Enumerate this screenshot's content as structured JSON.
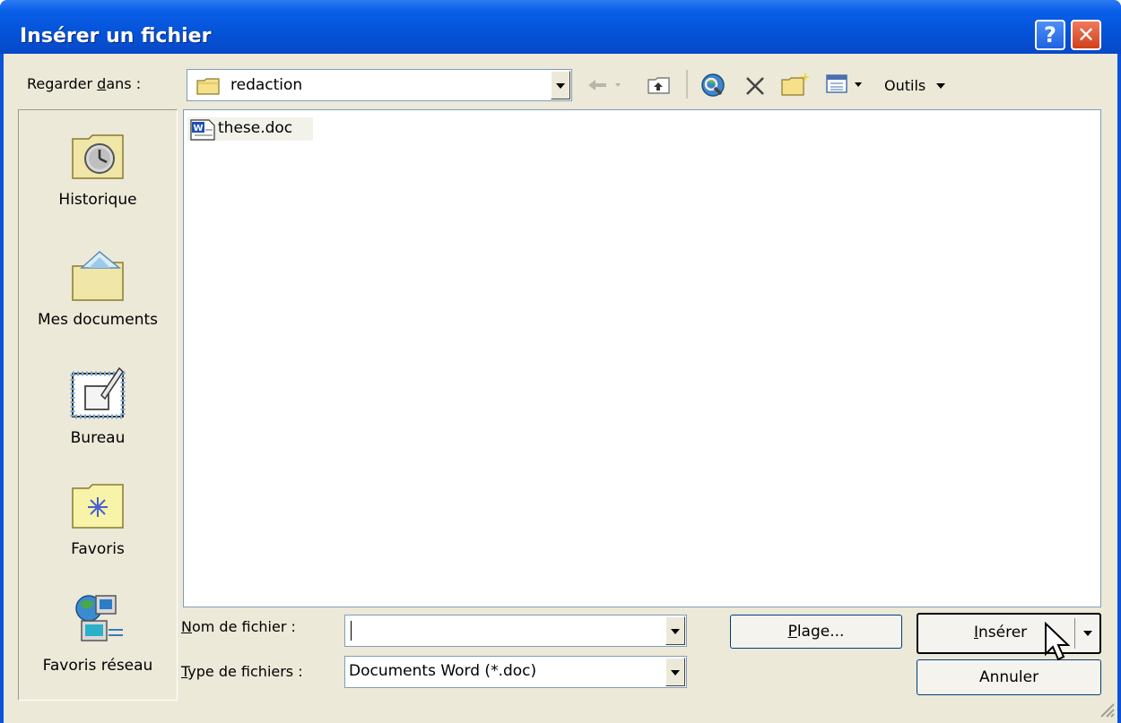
{
  "window": {
    "title": "Insérer un fichier",
    "help_glyph": "?",
    "close_glyph": "✕"
  },
  "toolbar": {
    "look_in_label_pre": "Regarder ",
    "look_in_label_u": "d",
    "look_in_label_post": "ans :",
    "current_folder": "redaction",
    "tools_label": "Outils"
  },
  "places": [
    {
      "label": "Historique",
      "icon": "history-icon"
    },
    {
      "label": "Mes documents",
      "icon": "my-documents-icon"
    },
    {
      "label": "Bureau",
      "icon": "desktop-icon"
    },
    {
      "label": "Favoris",
      "icon": "favorites-icon"
    },
    {
      "label": "Favoris réseau",
      "icon": "network-favorites-icon"
    }
  ],
  "files": [
    {
      "name": "these.doc",
      "icon": "word-document-icon"
    }
  ],
  "form": {
    "filename_label_u": "N",
    "filename_label_post": "om de fichier :",
    "filename_value": "",
    "filetype_label_u": "T",
    "filetype_label_post": "ype de fichiers :",
    "filetype_value": "Documents Word (*.doc)"
  },
  "buttons": {
    "range_u": "P",
    "range_post": "lage...",
    "insert_u": "I",
    "insert_post": "nsérer",
    "cancel": "Annuler"
  },
  "colors": {
    "titlebar": "#0453d8",
    "dialog_bg": "#ece9d8",
    "close_button": "#d2401a",
    "border": "#7f9db9"
  }
}
